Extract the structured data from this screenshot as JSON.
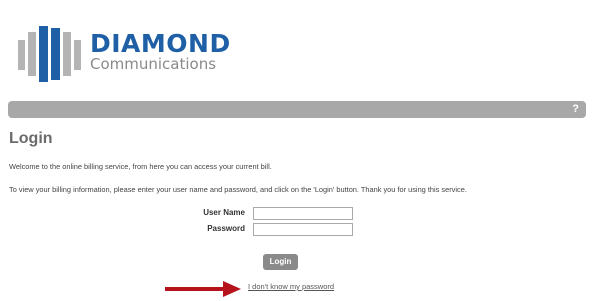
{
  "brand": {
    "name": "DIAMOND",
    "subtitle": "Communications",
    "name_color": "#1e5fa6",
    "bar_colors": [
      "#1e5fa6",
      "#b4b4b4"
    ]
  },
  "topbar": {
    "help_label": "?"
  },
  "page": {
    "title": "Login",
    "welcome_text": "Welcome to the online billing service, from here you can access your current bill.",
    "instructions_text": "To view your billing information, please enter your user name and password, and click on the 'Login' button. Thank you for using this service."
  },
  "form": {
    "username_label": "User Name",
    "username_value": "",
    "password_label": "Password",
    "password_value": "",
    "login_label": "Login",
    "forgot_link": "I don't know my password"
  },
  "annotation": {
    "arrow_color": "#b5121b"
  }
}
